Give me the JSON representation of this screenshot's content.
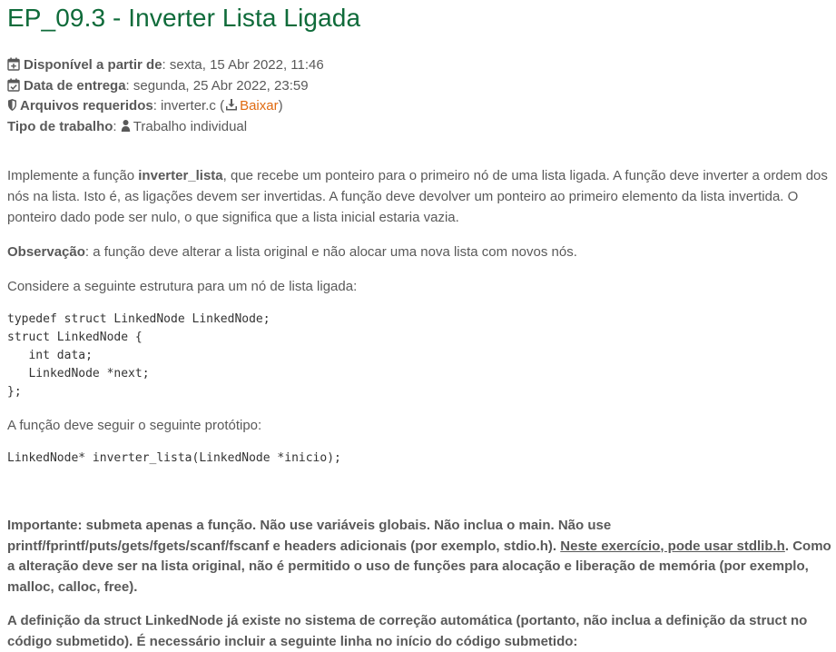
{
  "title": "EP_09.3 - Inverter Lista Ligada",
  "meta": {
    "available_label": "Disponível a partir de",
    "available_value": ": sexta, 15 Abr 2022, 11:46",
    "due_label": "Data de entrega",
    "due_value": ": segunda, 25 Abr 2022, 23:59",
    "files_label": "Arquivos requeridos",
    "files_value": ": inverter.c (",
    "download_label": "Baixar",
    "files_close": ")",
    "work_type_label": "Tipo de trabalho",
    "work_type_sep": ": ",
    "work_type_value": "Trabalho individual"
  },
  "description": {
    "p1_pre": "Implemente a função ",
    "p1_fn": "inverter_lista",
    "p1_post": ", que recebe um ponteiro para o primeiro nó de uma lista ligada. A função deve inverter a ordem dos nós na lista. Isto é, as ligações devem ser invertidas. A função deve devolver um ponteiro ao primeiro elemento da lista invertida. O ponteiro dado pode ser nulo, o que significa que a lista inicial estaria vazia.",
    "note_label": "Observação",
    "note_text": ": a função deve alterar a lista original e não alocar uma nova lista com novos nós.",
    "struct_intro": "Considere a seguinte estrutura para um nó de lista ligada:",
    "struct_code": "typedef struct LinkedNode LinkedNode;\nstruct LinkedNode {\n   int data;\n   LinkedNode *next;\n};",
    "proto_intro": "A função deve seguir o seguinte protótipo:",
    "proto_code": "LinkedNode* inverter_lista(LinkedNode *inicio);",
    "important_pre": "Importante: submeta apenas a função. Não use variáveis globais. Não inclua o main. Não use printf/fprintf/puts/gets/fgets/scanf/fscanf e headers adicionais (por exemplo, stdio.h). ",
    "important_underline": "Neste exercício, pode usar stdlib.h",
    "important_post": ". Como a alteração deve ser na lista original, não é permitido o uso de funções para alocação e liberação de memória (por exemplo, malloc, calloc, free).",
    "definition_text": "A definição da struct LinkedNode já existe no sistema de correção automática (portanto, não inclua a definição da struct no código submetido). É necessário incluir a seguinte linha no início do código submetido:"
  },
  "icons": {
    "available": "calendar-plus-icon",
    "due": "calendar-check-icon",
    "files": "shield-icon",
    "download": "download-icon",
    "work_type": "user-icon"
  },
  "colors": {
    "title": "#0f6b3a",
    "link": "#e06a10",
    "text": "#595959"
  }
}
